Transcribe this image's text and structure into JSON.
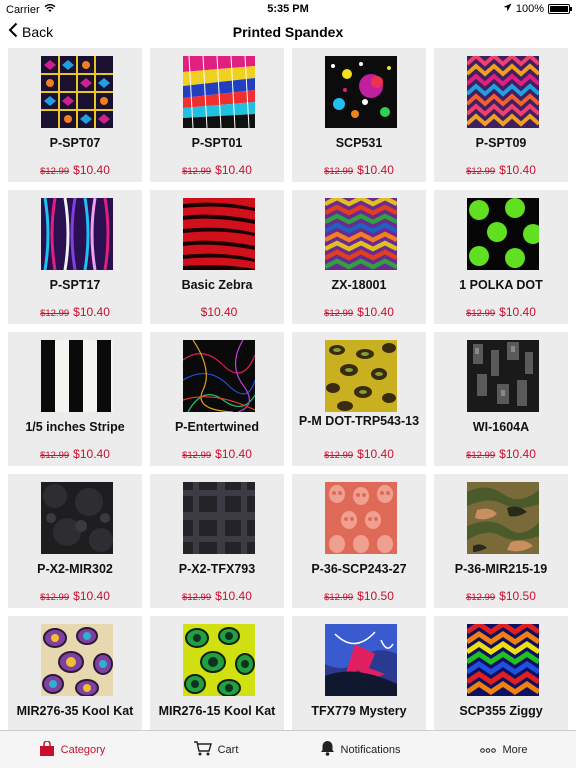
{
  "status": {
    "carrier": "Carrier",
    "time": "5:35 PM",
    "battery": "100%",
    "battery_level": 1.0
  },
  "nav": {
    "back_label": "Back",
    "title": "Printed Spandex"
  },
  "products": [
    {
      "name": "P-SPT07",
      "old_price": "$12.99",
      "price": "$10.40"
    },
    {
      "name": "P-SPT01",
      "old_price": "$12.99",
      "price": "$10.40"
    },
    {
      "name": "SCP531",
      "old_price": "$12.99",
      "price": "$10.40"
    },
    {
      "name": "P-SPT09",
      "old_price": "$12.99",
      "price": "$10.40"
    },
    {
      "name": "P-SPT17",
      "old_price": "$12.99",
      "price": "$10.40"
    },
    {
      "name": "Basic Zebra",
      "old_price": "",
      "price": "$10.40"
    },
    {
      "name": "ZX-18001",
      "old_price": "$12.99",
      "price": "$10.40"
    },
    {
      "name": "1 POLKA DOT",
      "old_price": "$12.99",
      "price": "$10.40"
    },
    {
      "name": "1/5 inches Stripe",
      "old_price": "$12.99",
      "price": "$10.40"
    },
    {
      "name": "P-Entertwined",
      "old_price": "$12.99",
      "price": "$10.40"
    },
    {
      "name": "P-M DOT-TRP543-13",
      "old_price": "$12.99",
      "price": "$10.40"
    },
    {
      "name": "WI-1604A",
      "old_price": "$12.99",
      "price": "$10.40"
    },
    {
      "name": "P-X2-MIR302",
      "old_price": "$12.99",
      "price": "$10.40"
    },
    {
      "name": "P-X2-TFX793",
      "old_price": "$12.99",
      "price": "$10.40"
    },
    {
      "name": "P-36-SCP243-27",
      "old_price": "$12.99",
      "price": "$10.50"
    },
    {
      "name": "P-36-MIR215-19",
      "old_price": "$12.99",
      "price": "$10.50"
    },
    {
      "name": "MIR276-35 Kool Kat",
      "old_price": "",
      "price": ""
    },
    {
      "name": "MIR276-15 Kool Kat",
      "old_price": "",
      "price": ""
    },
    {
      "name": "TFX779 Mystery",
      "old_price": "",
      "price": ""
    },
    {
      "name": "SCP355 Ziggy",
      "old_price": "",
      "price": ""
    }
  ],
  "tabs": [
    {
      "label": "Category",
      "icon": "bag-icon",
      "active": true
    },
    {
      "label": "Cart",
      "icon": "cart-icon",
      "active": false
    },
    {
      "label": "Notifications",
      "icon": "bell-icon",
      "active": false
    },
    {
      "label": "More",
      "icon": "more-dots-icon",
      "active": false
    }
  ],
  "colors": {
    "accent": "#c8102e",
    "card_bg": "#ececec"
  }
}
